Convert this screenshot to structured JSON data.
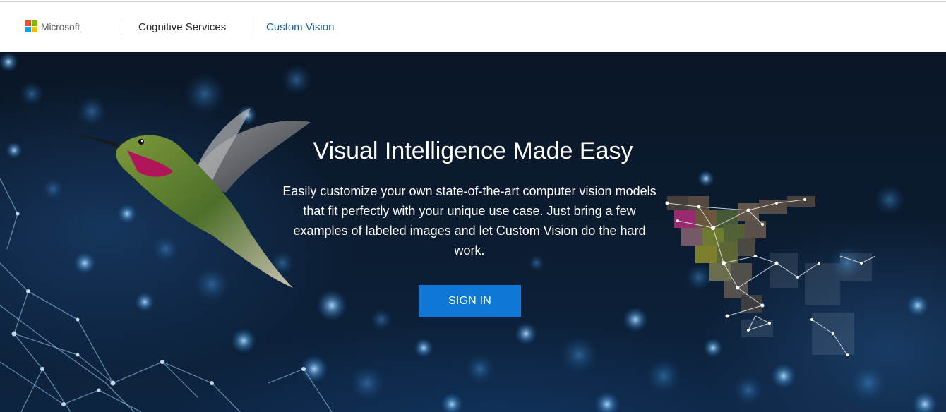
{
  "header": {
    "brand_name": "Microsoft",
    "brand_colors": [
      "#f25022",
      "#7fba00",
      "#00a4ef",
      "#ffb900"
    ],
    "nav": {
      "cognitive_services": "Cognitive Services",
      "custom_vision": "Custom Vision"
    }
  },
  "hero": {
    "title": "Visual Intelligence Made Easy",
    "description": "Easily customize your own state-of-the-art computer vision models that fit perfectly with your unique use case. Just bring a few examples of labeled images and let Custom Vision do the hard work.",
    "sign_in_label": "SIGN IN",
    "accent_color": "#0f78d4",
    "images": [
      "hummingbird-photo",
      "pixelated-hummingbird-network-graphic"
    ]
  }
}
